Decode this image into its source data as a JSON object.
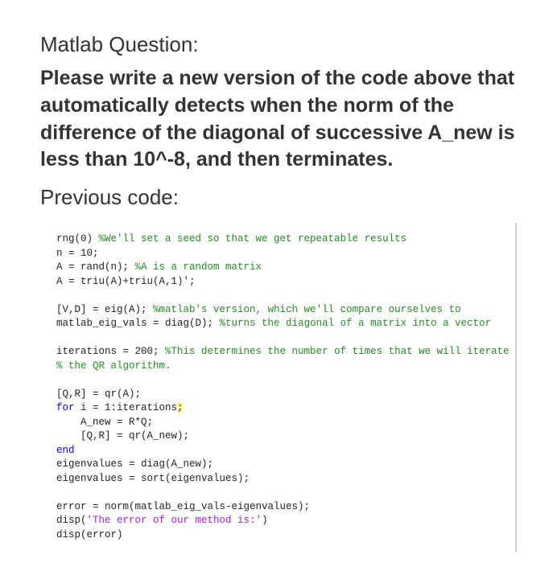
{
  "header": {
    "title": "Matlab Question:",
    "question": "Please write a new version of the code above that automatically detects when the norm of the difference of the diagonal of successive A_new is less than 10^-8, and then terminates.",
    "previous_label": "Previous code:"
  },
  "code": {
    "l1a": "rng(0) ",
    "l1b": "%We'll set a seed so that we get repeatable results",
    "l2": "n = 10;",
    "l3a": "A = rand(n); ",
    "l3b": "%A is a random matrix",
    "l4": "A = triu(A)+triu(A,1)';",
    "l5": "",
    "l6a": "[V,D] = eig(A); ",
    "l6b": "%matlab's version, which we'll compare ourselves to",
    "l7a": "matlab_eig_vals = diag(D); ",
    "l7b": "%turns the diagonal of a matrix into a vector",
    "l8": "",
    "l9a": "iterations = 200; ",
    "l9b": "%This determines the number of times that we will iterate",
    "l10": "% the QR algorithm.",
    "l11": "",
    "l12": "[Q,R] = qr(A);",
    "l13a": "for",
    "l13b": " i = 1:iterations",
    "l13c": ";",
    "l14": "    A_new = R*Q;",
    "l15": "    [Q,R] = qr(A_new);",
    "l16": "end",
    "l17": "eigenvalues = diag(A_new);",
    "l18": "eigenvalues = sort(eigenvalues);",
    "l19": "",
    "l20": "error = norm(matlab_eig_vals-eigenvalues);",
    "l21a": "disp(",
    "l21b": "'The error of our method is:'",
    "l21c": ")",
    "l22": "disp(error)"
  }
}
